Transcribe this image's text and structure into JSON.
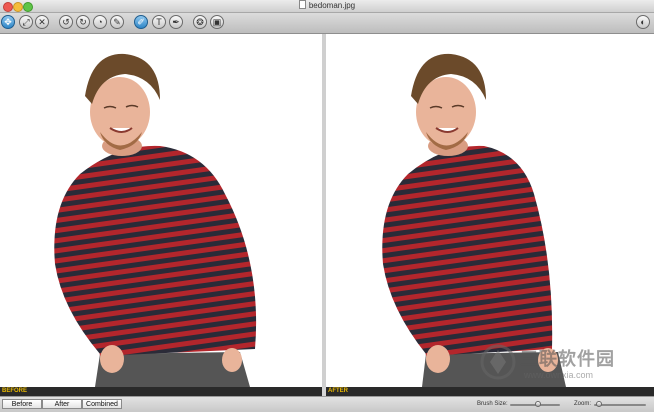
{
  "window": {
    "title": "bedoman.jpg"
  },
  "toolbar": {
    "tools": [
      {
        "name": "move-tool-icon",
        "glyph": "✥",
        "active": true
      },
      {
        "name": "resize-tool-icon",
        "glyph": "⤢",
        "active": false
      },
      {
        "name": "shrink-tool-icon",
        "glyph": "✕",
        "active": false
      },
      {
        "name": "rotate-left-icon",
        "glyph": "↺",
        "active": false
      },
      {
        "name": "rotate-right-icon",
        "glyph": "↻",
        "active": false
      },
      {
        "name": "twirl-icon",
        "glyph": "◔",
        "active": false
      },
      {
        "name": "smudge-icon",
        "glyph": "✎",
        "active": false
      },
      {
        "name": "brush-tool-icon",
        "glyph": "✐",
        "active": true
      },
      {
        "name": "text-tool-icon",
        "glyph": "T",
        "active": false
      },
      {
        "name": "pen-tool-icon",
        "glyph": "✒",
        "active": false
      },
      {
        "name": "effects-icon",
        "glyph": "❂",
        "active": false
      },
      {
        "name": "export-icon",
        "glyph": "▣",
        "active": false
      }
    ],
    "right_tool": {
      "name": "view-toggle-icon",
      "glyph": "◐"
    }
  },
  "panels": {
    "before_label": "BEFORE",
    "after_label": "AFTER"
  },
  "statusbar": {
    "view_before": "Before",
    "view_after": "After",
    "view_combined": "Combined",
    "brush_size_label": "Brush Size:",
    "brush_size_fraction": 0.55,
    "zoom_label": "Zoom:",
    "zoom_fraction": 0.1
  },
  "watermark": {
    "text": "三联软件园",
    "subtext": "www.ownxia.com"
  },
  "colors": {
    "shirt_red": "#b3262c",
    "shirt_dark": "#2b2b38",
    "skin": "#e9b49a",
    "label_yellow": "#e8b800"
  }
}
